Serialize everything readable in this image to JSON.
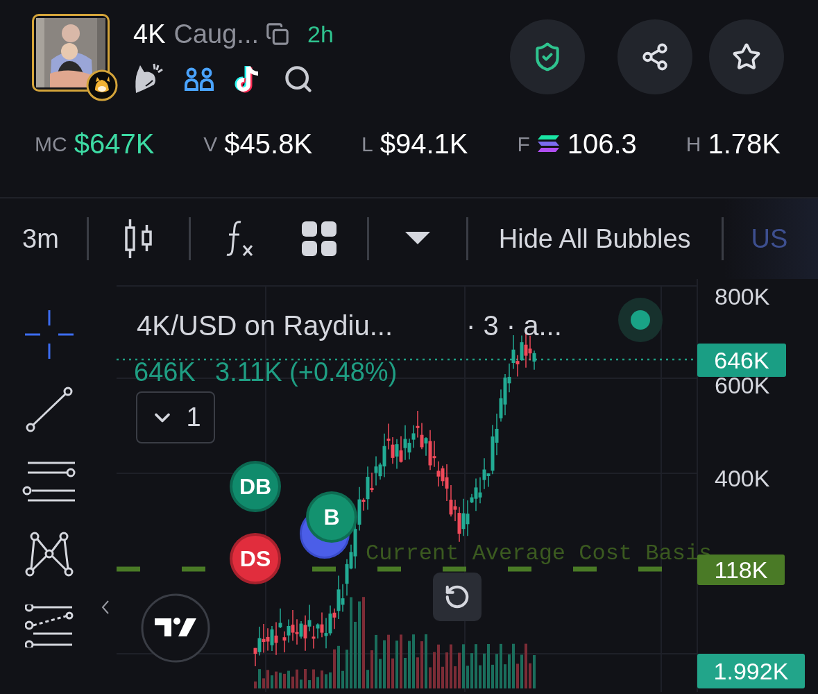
{
  "token": {
    "symbol": "4K",
    "name": "Caug...",
    "age": "2h"
  },
  "stats": [
    {
      "label": "MC",
      "value": "$647K",
      "kind": "highlight"
    },
    {
      "label": "V",
      "value": "$45.8K",
      "kind": "plain"
    },
    {
      "label": "L",
      "value": "$94.1K",
      "kind": "plain"
    },
    {
      "label": "F",
      "value": "106.3",
      "kind": "token"
    },
    {
      "label": "H",
      "value": "1.78K",
      "kind": "plain"
    }
  ],
  "toolbar": {
    "interval": "3m",
    "bubbles_button": "Hide All Bubbles",
    "currency": "US"
  },
  "chart": {
    "title": "4K/USD on Raydiu...",
    "title_suffix": "· 3 · a...",
    "price": "646K",
    "change": "3.11K (+0.48%)",
    "indicators_count": "1",
    "price_axis": [
      "800K",
      "600K",
      "400K"
    ],
    "price_tag": "646K",
    "cost_basis": {
      "label": "Current Average Cost Basis",
      "tag": "118K"
    },
    "volume_tag": "1.992K",
    "bubbles": [
      {
        "label": "DB",
        "color": "#108b6c"
      },
      {
        "label": "B",
        "color": "#13926f"
      },
      {
        "label": "DS",
        "color": "#e12d3d"
      }
    ]
  }
}
